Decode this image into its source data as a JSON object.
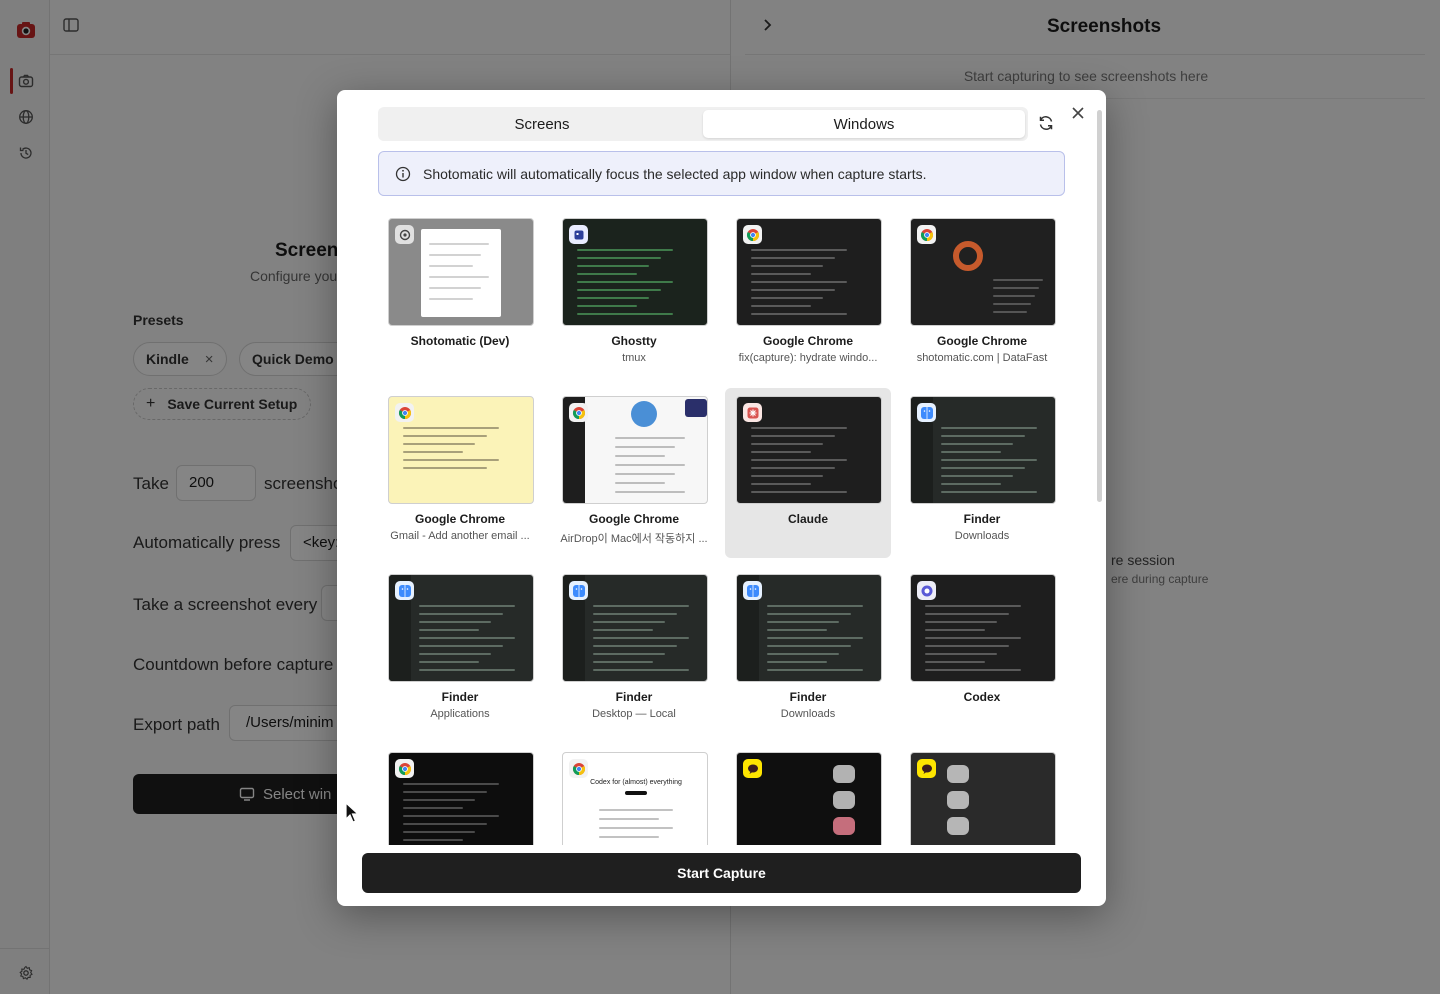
{
  "app": {
    "screenshots_title": "Screenshots",
    "screenshots_empty": "Start capturing to see screenshots here",
    "session_title": "re session",
    "session_sub": "ere during capture",
    "config_title": "Screen",
    "config_sub": "Configure you",
    "presets_label": "Presets",
    "presets": [
      {
        "label": "Kindle",
        "close": "×"
      },
      {
        "label": "Quick Demo"
      }
    ],
    "save_setup_label": "Save Current Setup",
    "take_label": "Take",
    "take_value": "200",
    "take_suffix": "screensho",
    "auto_press_label": "Automatically press",
    "auto_press_value": "<key:",
    "every_label": "Take a screenshot every",
    "countdown_label": "Countdown before capture",
    "export_label": "Export path",
    "export_value": "/Users/minim",
    "select_window_label": "Select win"
  },
  "modal": {
    "tabs": [
      {
        "label": "Screens",
        "active": false
      },
      {
        "label": "Windows",
        "active": true
      }
    ],
    "info_text": "Shotomatic will automatically focus the selected app window when capture starts.",
    "start_label": "Start Capture",
    "windows": [
      {
        "name": "Shotomatic (Dev)",
        "sub": "",
        "theme": "light-gray",
        "badge": "gear",
        "selected": false
      },
      {
        "name": "Ghostty",
        "sub": "tmux",
        "theme": "terminal-green",
        "badge": "ghost",
        "selected": false
      },
      {
        "name": "Google Chrome",
        "sub": "fix(capture): hydrate windo...",
        "theme": "dark",
        "badge": "chrome",
        "selected": false
      },
      {
        "name": "Google Chrome",
        "sub": "shotomatic.com | DataFast",
        "theme": "dark-donut",
        "badge": "chrome",
        "selected": false
      },
      {
        "name": "Google Chrome",
        "sub": "Gmail - Add another email ...",
        "theme": "yellow",
        "badge": "chrome",
        "selected": false
      },
      {
        "name": "Google Chrome",
        "sub": "AirDrop이 Mac에서 작동하지 ...",
        "theme": "white-doc",
        "badge": "chrome",
        "selected": false
      },
      {
        "name": "Claude",
        "sub": "",
        "theme": "dark",
        "badge": "claude",
        "selected": true
      },
      {
        "name": "Finder",
        "sub": "Downloads",
        "theme": "finder",
        "badge": "finder",
        "selected": false
      },
      {
        "name": "Finder",
        "sub": "Applications",
        "theme": "finder",
        "badge": "finder",
        "selected": false
      },
      {
        "name": "Finder",
        "sub": "Desktop — Local",
        "theme": "finder",
        "badge": "finder",
        "selected": false
      },
      {
        "name": "Finder",
        "sub": "Downloads",
        "theme": "finder",
        "badge": "finder",
        "selected": false
      },
      {
        "name": "Codex",
        "sub": "",
        "theme": "dark",
        "badge": "codex",
        "selected": false
      },
      {
        "name": "",
        "sub": "",
        "theme": "black",
        "badge": "chrome",
        "selected": false
      },
      {
        "name": "",
        "sub": "",
        "theme": "white-codex",
        "badge": "chrome",
        "thumb_text": "Codex for (almost) everything",
        "selected": false
      },
      {
        "name": "",
        "sub": "",
        "theme": "black-chat",
        "badge": "kakao",
        "selected": false
      },
      {
        "name": "",
        "sub": "",
        "theme": "dark-chat",
        "badge": "kakao",
        "selected": false
      }
    ]
  },
  "colors": {
    "accent_red": "#c62828",
    "button_dark": "#1f1f1f",
    "info_bg": "#eef0fb",
    "info_border": "#b9c0ea"
  }
}
